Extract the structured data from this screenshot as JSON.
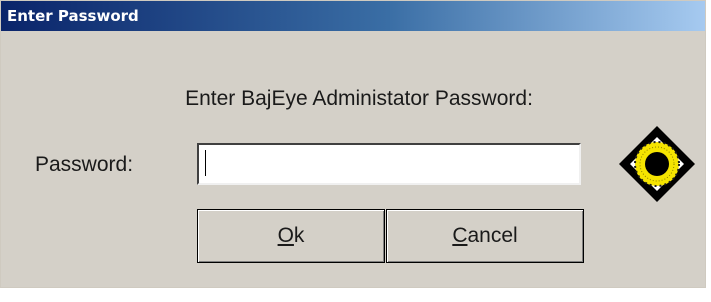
{
  "window": {
    "title": "Enter Password"
  },
  "dialog": {
    "prompt": "Enter BajEye Administator Password:",
    "password_label": "Password:",
    "password_value": "",
    "ok": {
      "mnemonic": "O",
      "rest": "k"
    },
    "cancel": {
      "mnemonic": "C",
      "rest": "ancel"
    },
    "logo_icon": "bajeye-eye-icon"
  },
  "colors": {
    "title_gradient_start": "#0a246a",
    "title_gradient_end": "#a6caf0",
    "dialog_bg": "#d4d0c8",
    "logo_yellow": "#f5e400"
  }
}
